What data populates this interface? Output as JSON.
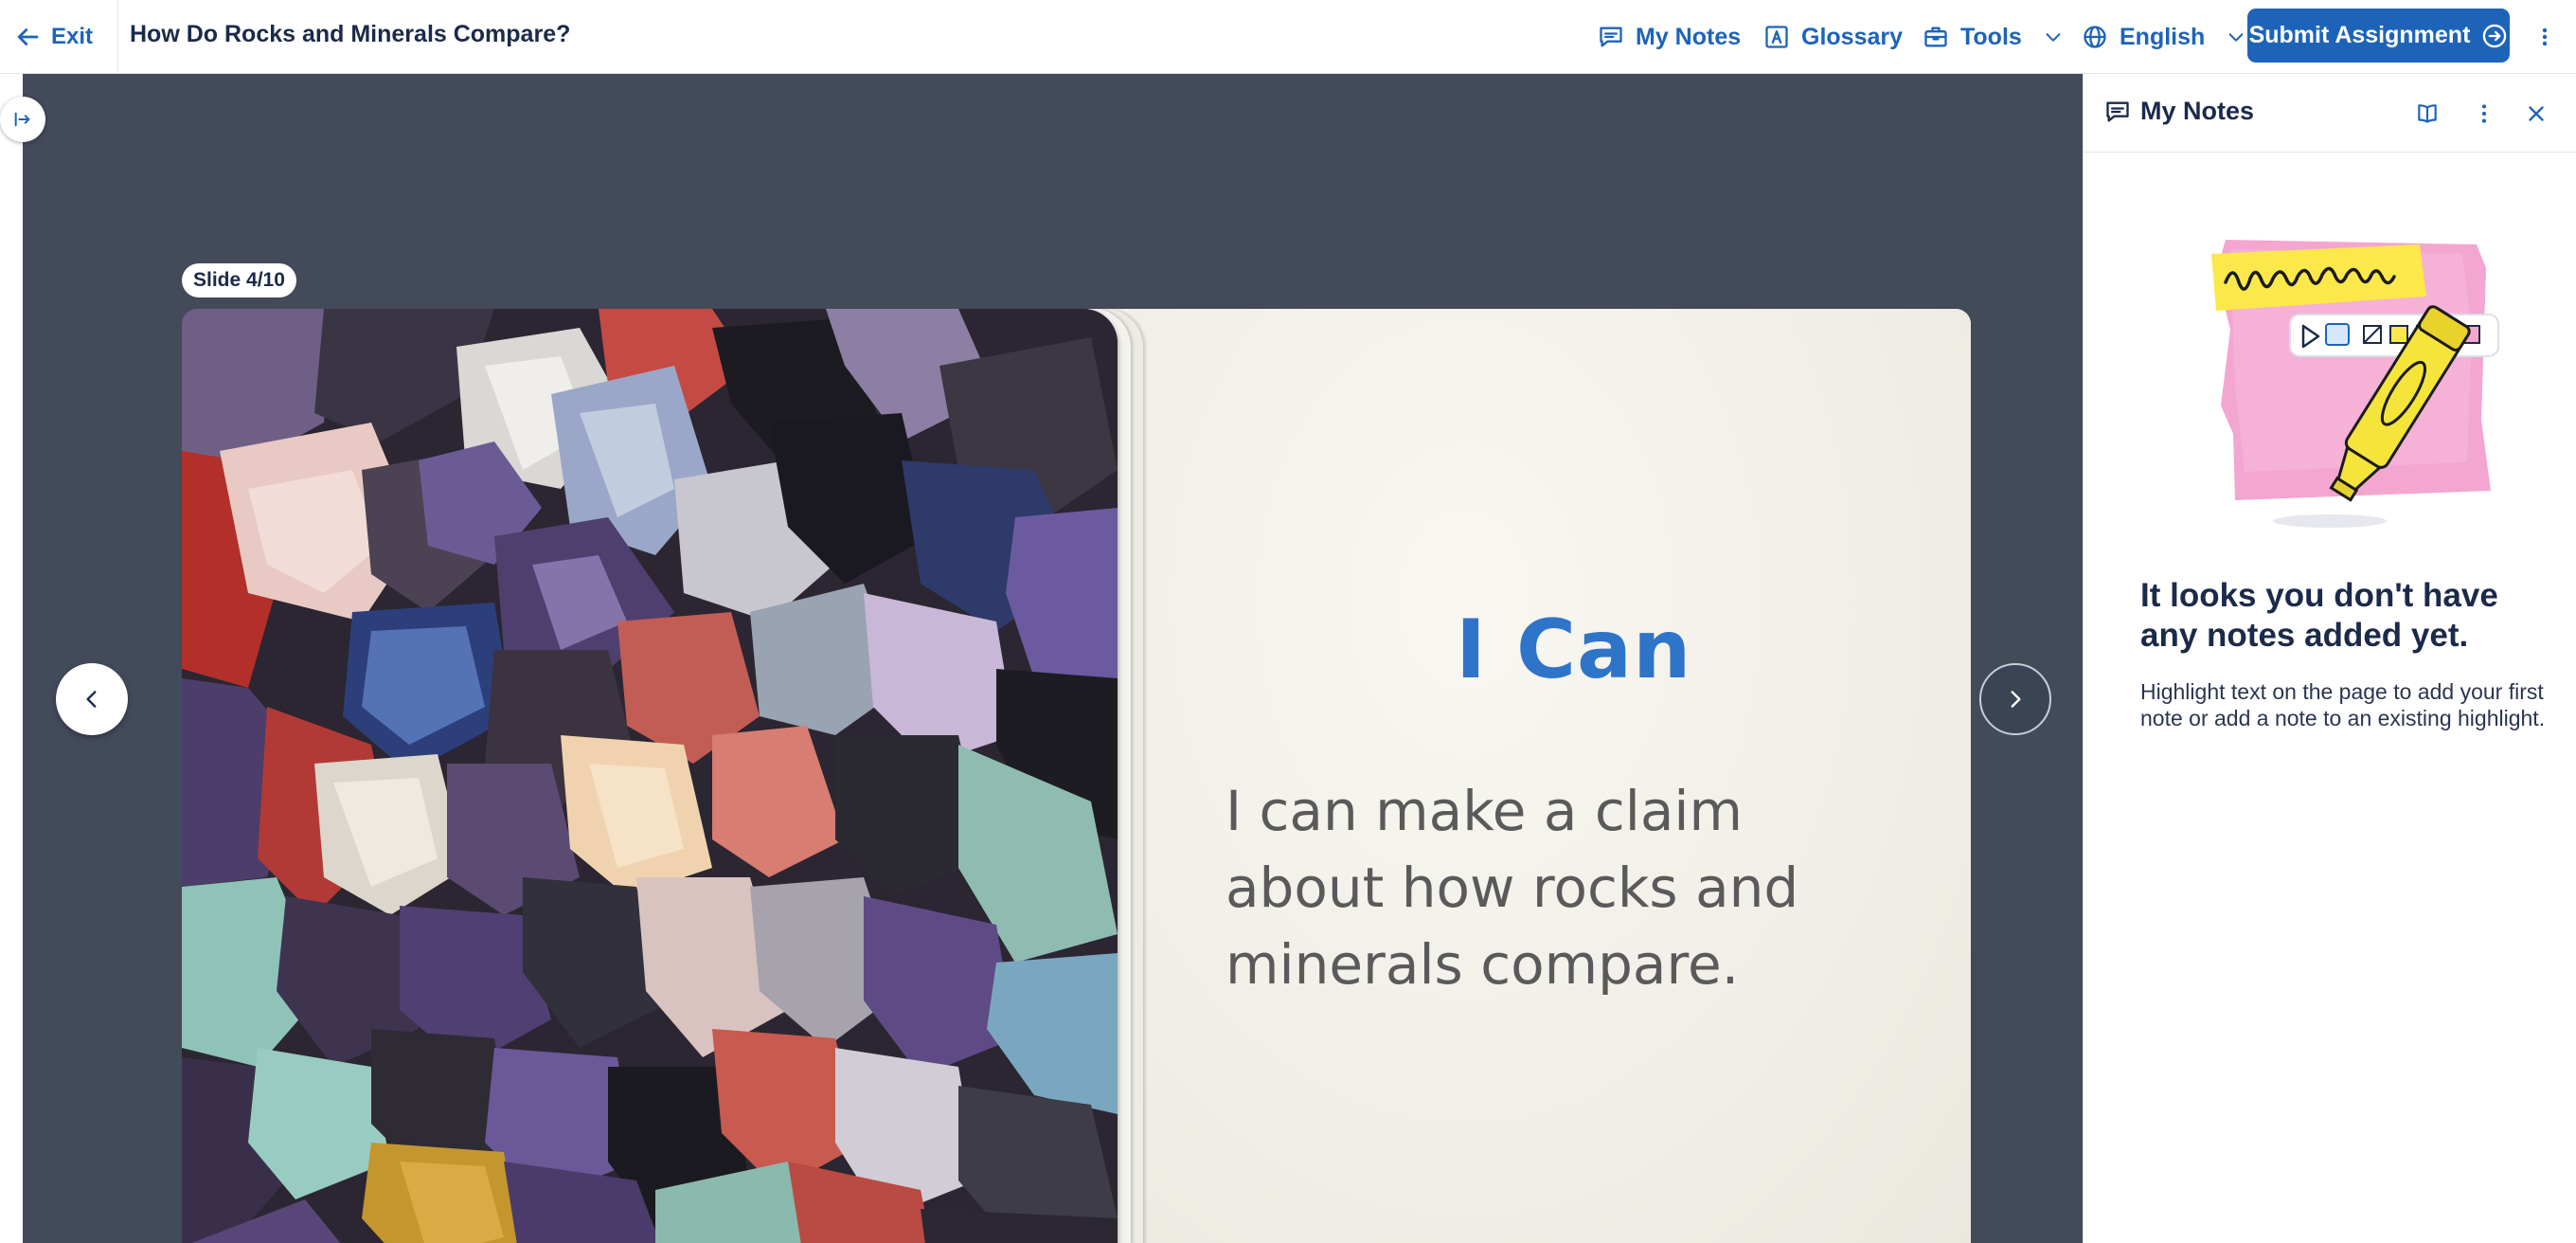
{
  "header": {
    "exit_label": "Exit",
    "title": "How Do Rocks and Minerals Compare?",
    "my_notes_label": "My Notes",
    "glossary_label": "Glossary",
    "tools_label": "Tools",
    "language_label": "English",
    "submit_label": "Submit Assignment"
  },
  "slide": {
    "counter": "Slide 4/10",
    "heading": "I Can",
    "body": "I can make a claim about how rocks and minerals compare."
  },
  "notes_panel": {
    "title": "My Notes",
    "empty_title": "It looks you don't have any notes added yet.",
    "empty_description": "Highlight text on the page to add your first note or add a note to an existing highlight."
  },
  "colors": {
    "accent": "#1d64b8",
    "stage_background": "#434a5a",
    "slide_heading": "#2e74c9",
    "text_dark": "#1b2a4a"
  },
  "icons": {
    "exit": "arrow-left-icon",
    "notes": "speech-bubble-icon",
    "glossary": "glossary-book-icon",
    "tools": "toolbox-icon",
    "language": "globe-icon",
    "submit": "arrow-circle-right-icon",
    "panel_book": "book-open-icon",
    "panel_more": "kebab-icon",
    "panel_close": "close-icon"
  }
}
